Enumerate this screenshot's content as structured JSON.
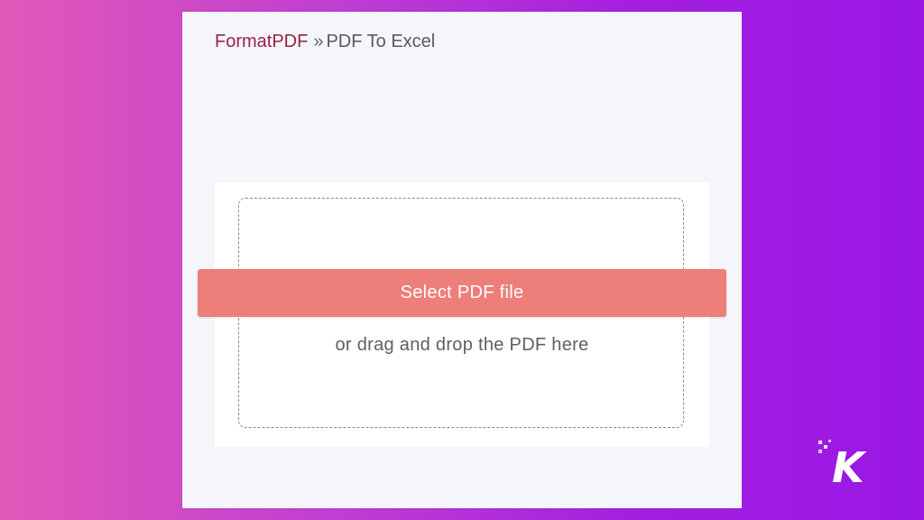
{
  "breadcrumb": {
    "brand": "FormatPDF",
    "separator": "»",
    "current": "PDF To Excel"
  },
  "upload": {
    "button_label": "Select PDF file",
    "drop_hint": "or drag and drop the PDF here"
  },
  "watermark": {
    "letter": "K"
  },
  "colors": {
    "brand": "#9b2242",
    "button": "#ee7e79",
    "panel_bg": "#f4f6fc"
  }
}
